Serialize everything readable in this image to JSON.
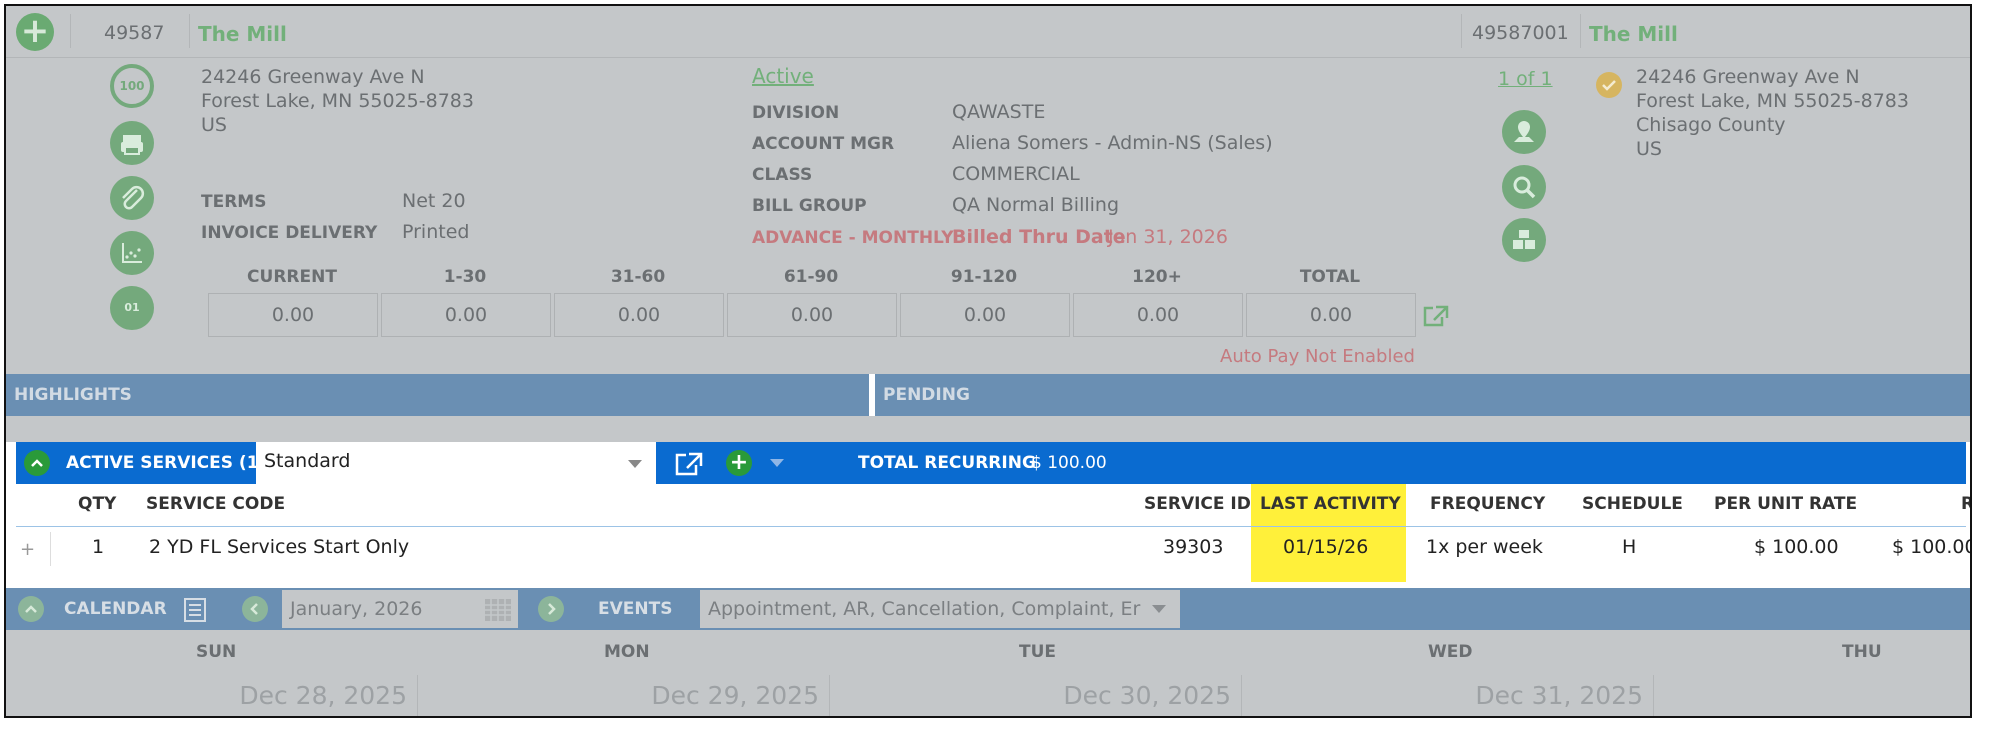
{
  "account": {
    "id": "49587",
    "name": "The Mill",
    "site_id": "49587001",
    "site_name": "The Mill"
  },
  "billing_address": [
    "24246 Greenway Ave N",
    "Forest Lake, MN 55025-8783",
    "US"
  ],
  "score_badge": "100",
  "terms": {
    "label": "TERMS",
    "value": "Net 20"
  },
  "invoice_delivery": {
    "label": "INVOICE DELIVERY",
    "value": "Printed"
  },
  "status_link": "Active",
  "details": [
    {
      "label": "DIVISION",
      "value": "QAWASTE"
    },
    {
      "label": "ACCOUNT MGR",
      "value": "Aliena Somers - Admin-NS (Sales)"
    },
    {
      "label": "CLASS",
      "value": "COMMERCIAL"
    },
    {
      "label": "BILL GROUP",
      "value": "QA Normal Billing"
    }
  ],
  "billing_cycle": {
    "label": "ADVANCE - MONTHLY",
    "billed_thru_label": "Billed Thru Date",
    "billed_thru_value": "Jan 31, 2026"
  },
  "site_pager": "1 of 1",
  "site_address": [
    "24246 Greenway Ave N",
    "Forest Lake, MN 55025-8783",
    "Chisago County",
    "US"
  ],
  "aging": {
    "headers": [
      "CURRENT",
      "1-30",
      "31-60",
      "61-90",
      "91-120",
      "120+",
      "TOTAL"
    ],
    "values": [
      "0.00",
      "0.00",
      "0.00",
      "0.00",
      "0.00",
      "0.00",
      "0.00"
    ]
  },
  "autopay_status": "Auto Pay Not Enabled",
  "sections": {
    "highlights": "HIGHLIGHTS",
    "pending": "PENDING"
  },
  "active_services": {
    "title": "ACTIVE SERVICES (1)",
    "view_select": "Standard",
    "total_label": "TOTAL RECURRING",
    "total_value": "$ 100.00",
    "columns": [
      "QTY",
      "SERVICE CODE",
      "SERVICE ID",
      "LAST ACTIVITY",
      "FREQUENCY",
      "SCHEDULE",
      "PER UNIT RATE",
      "R"
    ],
    "rows": [
      {
        "expand": "+",
        "qty": "1",
        "service_code": "2 YD FL Services Start Only",
        "service_id": "39303",
        "last_activity": "01/15/26",
        "frequency": "1x per week",
        "schedule": "H",
        "per_unit_rate": "$ 100.00",
        "rate": "$ 100.00"
      }
    ],
    "highlight_color": "#fff03a"
  },
  "calendar": {
    "title": "CALENDAR",
    "month": "January, 2026",
    "events_label": "EVENTS",
    "events_filter": "Appointment, AR, Cancellation, Complaint, Er",
    "day_headers": [
      "SUN",
      "MON",
      "TUE",
      "WED",
      "THU"
    ],
    "dates": [
      "Dec 28, 2025",
      "Dec 29, 2025",
      "Dec 30, 2025",
      "Dec 31, 2025"
    ]
  },
  "colors": {
    "accent_blue": "#0a6bd0",
    "section_blue": "#6a8fb3",
    "green": "#72b07a",
    "alert_red": "#c57a7f"
  }
}
